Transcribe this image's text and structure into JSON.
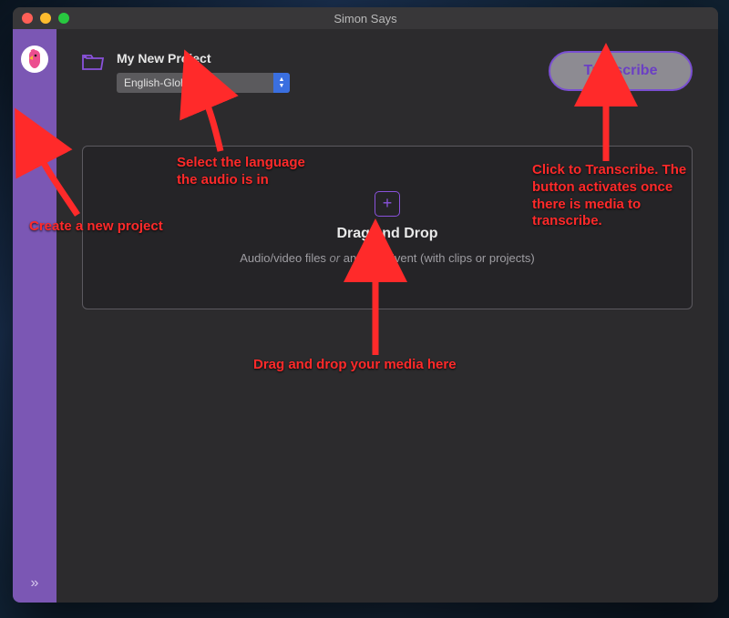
{
  "window": {
    "title": "Simon Says"
  },
  "sidebar": {
    "plus_glyph": "+",
    "expand_glyph": "»"
  },
  "header": {
    "project_title": "My New Project",
    "language_selected": "English-Global",
    "transcribe_label": "Transcribe"
  },
  "dropzone": {
    "icon_glyph": "+",
    "title": "Drag and Drop",
    "sub_prefix": "Audio/video files ",
    "sub_or": "or",
    "sub_suffix": " an FCP Event (with clips or projects)"
  },
  "annotations": {
    "new_project": "Create a new project",
    "language_line1": "Select the language",
    "language_line2": "the audio is in",
    "transcribe_line1": "Click to Transcribe. The",
    "transcribe_line2": "button activates once",
    "transcribe_line3": "there is media to",
    "transcribe_line4": "transcribe.",
    "dragdrop": "Drag and drop your media here"
  }
}
